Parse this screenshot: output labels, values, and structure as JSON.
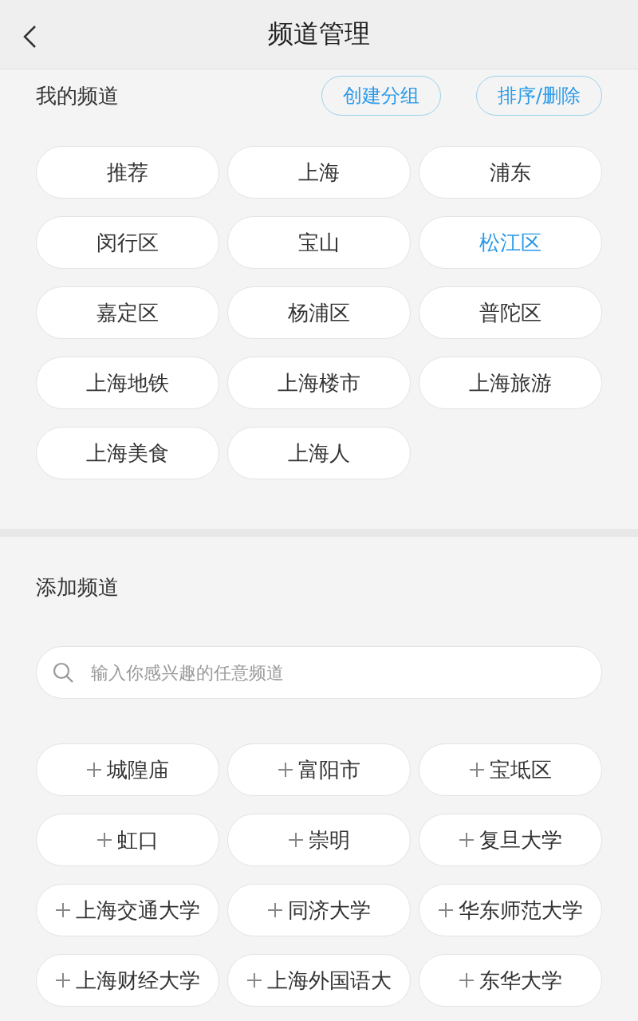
{
  "header": {
    "title": "频道管理"
  },
  "my_channels": {
    "title": "我的频道",
    "buttons": [
      "创建分组",
      "排序/删除"
    ],
    "items": [
      {
        "label": "推荐",
        "selected": false
      },
      {
        "label": "上海",
        "selected": false
      },
      {
        "label": "浦东",
        "selected": false
      },
      {
        "label": "闵行区",
        "selected": false
      },
      {
        "label": "宝山",
        "selected": false
      },
      {
        "label": "松江区",
        "selected": true
      },
      {
        "label": "嘉定区",
        "selected": false
      },
      {
        "label": "杨浦区",
        "selected": false
      },
      {
        "label": "普陀区",
        "selected": false
      },
      {
        "label": "上海地铁",
        "selected": false
      },
      {
        "label": "上海楼市",
        "selected": false
      },
      {
        "label": "上海旅游",
        "selected": false
      },
      {
        "label": "上海美食",
        "selected": false
      },
      {
        "label": "上海人",
        "selected": false
      }
    ]
  },
  "add_channels": {
    "title": "添加频道",
    "search": {
      "placeholder": "输入你感兴趣的任意频道"
    },
    "items": [
      "城隍庙",
      "富阳市",
      "宝坻区",
      "虹口",
      "崇明",
      "复旦大学",
      "上海交通大学",
      "同济大学",
      "华东师范大学",
      "上海财经大学",
      "上海外国语大",
      "东华大学"
    ]
  }
}
